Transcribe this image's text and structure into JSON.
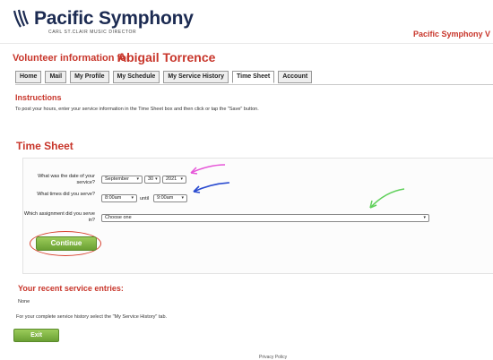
{
  "header": {
    "org_name": "Pacific Symphony",
    "org_subtitle": "CARL ST.CLAIR MUSIC DIRECTOR",
    "site_title": "Pacific Symphony V",
    "brand_color": "#1c2b52",
    "accent_color": "#c8362b",
    "logo_icon": "symphony-logo-icon"
  },
  "volunteer": {
    "prefix": "Volunteer information for",
    "name": "Abigail Torrence"
  },
  "tabs": [
    {
      "label": "Home",
      "active": false
    },
    {
      "label": "Mail",
      "active": false
    },
    {
      "label": "My Profile",
      "active": false
    },
    {
      "label": "My Schedule",
      "active": false
    },
    {
      "label": "My Service History",
      "active": false
    },
    {
      "label": "Time Sheet",
      "active": true
    },
    {
      "label": "Account",
      "active": false
    }
  ],
  "instructions": {
    "title": "Instructions",
    "text": "To post your hours, enter your service information in the Time Sheet box and then click or tap the \"Save\" button."
  },
  "timesheet": {
    "title": "Time Sheet",
    "date_question": "What was the date of your service?",
    "month": "September",
    "day": "30",
    "year": "2021",
    "time_question": "What times did you serve?",
    "start_time": "8:00am",
    "until_label": "until",
    "end_time": "9:00am",
    "assignment_question": "Which assignment did you serve in?",
    "assignment_value": "Choose one",
    "continue_label": "Continue",
    "annotation_colors": {
      "date": "#e655d8",
      "time": "#2a4bd0",
      "assignment": "#5fd05a",
      "continue_ring": "#d8422f"
    }
  },
  "recent": {
    "title": "Your recent service entries:",
    "none_text": "None",
    "history_note": "For your complete service history select the \"My Service History\" tab.",
    "exit_label": "Exit"
  },
  "footer": {
    "privacy": "Privacy Policy"
  }
}
